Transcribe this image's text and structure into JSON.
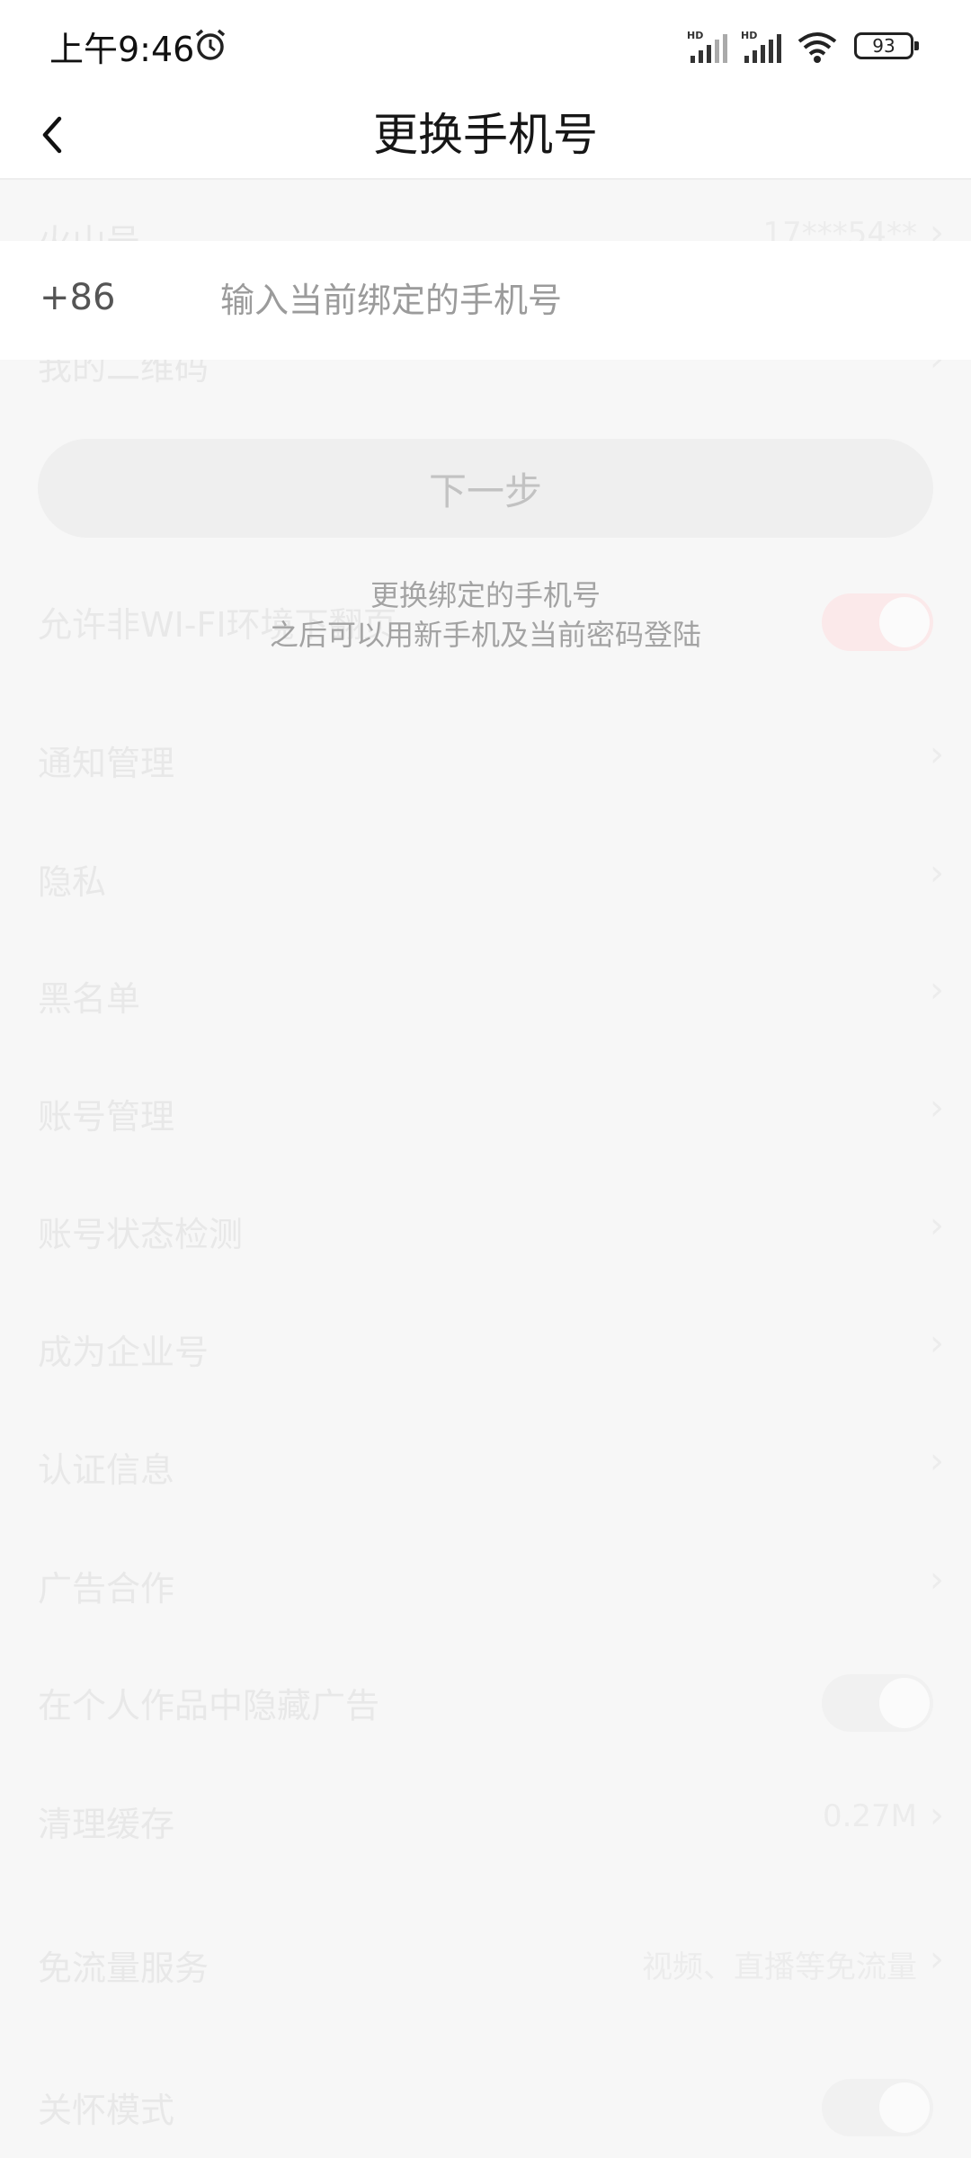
{
  "status_bar": {
    "time": "上午9:46",
    "battery": "93"
  },
  "header": {
    "title": "更换手机号"
  },
  "form": {
    "country_code": "+86",
    "phone_placeholder": "输入当前绑定的手机号",
    "phone_value": "",
    "next_label": "下一步",
    "hint_line1": "更换绑定的手机号",
    "hint_line2": "之后可以用新手机及当前密码登陆"
  },
  "background_settings": {
    "items": [
      {
        "label": "火山号",
        "value": "17***54**",
        "chevron": "›"
      },
      {
        "label": "我的二维码",
        "value": "",
        "chevron": "›"
      },
      {
        "label": "允许非WI-FI环境下翻页",
        "value": "",
        "chevron": ""
      },
      {
        "label": "通知管理",
        "value": "",
        "chevron": "›"
      },
      {
        "label": "隐私",
        "value": "",
        "chevron": "›"
      },
      {
        "label": "黑名单",
        "value": "",
        "chevron": "›"
      },
      {
        "label": "账号管理",
        "value": "",
        "chevron": "›"
      },
      {
        "label": "账号状态检测",
        "value": "",
        "chevron": "›"
      },
      {
        "label": "成为企业号",
        "value": "",
        "chevron": "›"
      },
      {
        "label": "认证信息",
        "value": "",
        "chevron": "›"
      },
      {
        "label": "广告合作",
        "value": "",
        "chevron": "›"
      },
      {
        "label": "在个人作品中隐藏广告",
        "value": "",
        "chevron": ""
      },
      {
        "label": "清理缓存",
        "value": "0.27M",
        "chevron": "›"
      },
      {
        "label": "免流量服务",
        "value": "视频、直播等免流量",
        "chevron": "›"
      },
      {
        "label": "关怀模式",
        "value": "",
        "chevron": ""
      }
    ]
  },
  "colors": {
    "toggle_on_faded": "#fbe9ea",
    "button_disabled_bg": "#efefef",
    "button_disabled_text": "#c2c2c2",
    "hint_text": "#a3a3a3"
  }
}
